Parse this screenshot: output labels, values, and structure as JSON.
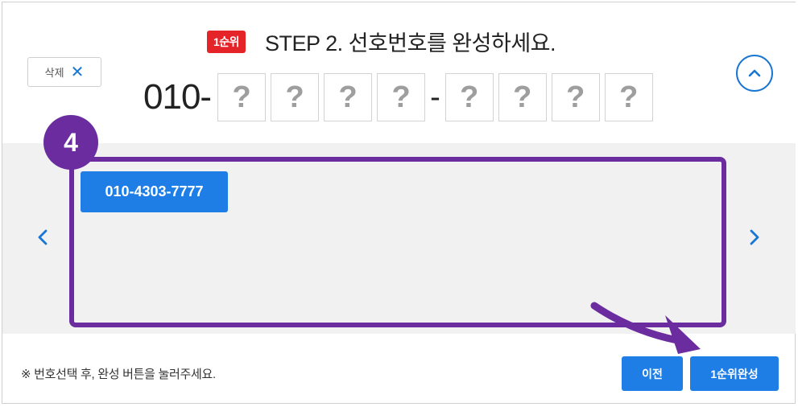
{
  "header": {
    "rank_badge": "1순위",
    "step_title": "STEP 2. 선호번호를 완성하세요."
  },
  "delete_button": {
    "label": "삭제",
    "icon": "close-icon"
  },
  "collapse_button": {
    "icon": "chevron-up-icon"
  },
  "phone": {
    "prefix": "010-",
    "middle_digits": [
      "?",
      "?",
      "?",
      "?"
    ],
    "separator": "-",
    "last_digits": [
      "?",
      "?",
      "?",
      "?"
    ]
  },
  "number_list": {
    "items": [
      "010-4303-7777"
    ],
    "prev_icon": "chevron-left-icon",
    "next_icon": "chevron-right-icon"
  },
  "annotation": {
    "step_number": "4",
    "color": "#6a2c9e"
  },
  "footer": {
    "notice": "※ 번호선택 후, 완성 버튼을 눌러주세요.",
    "prev_label": "이전",
    "complete_label": "1순위완성"
  },
  "colors": {
    "accent": "#1e7ee6",
    "badge": "#e5242a",
    "highlight": "#6a2c9e"
  }
}
